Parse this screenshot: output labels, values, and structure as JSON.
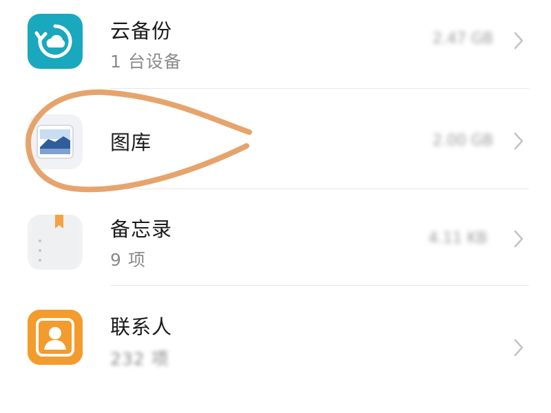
{
  "items": [
    {
      "title": "云备份",
      "subtitle": "1 台设备",
      "value": "2.47 GB",
      "icon": "cloud-backup-icon"
    },
    {
      "title": "图库",
      "subtitle": "",
      "value": "2.00 GB",
      "icon": "gallery-icon"
    },
    {
      "title": "备忘录",
      "subtitle": "9 项",
      "value": "4.11 KB",
      "icon": "notes-icon"
    },
    {
      "title": "联系人",
      "subtitle": "232 项",
      "value": "",
      "icon": "contacts-icon"
    }
  ],
  "colors": {
    "cloud_icon_bg": "#19a8bd",
    "contacts_icon_bg": "#f39b2c",
    "annotation_stroke": "#e39a5c",
    "title_text": "#1a1a1a",
    "subtitle_text": "#8a8a8a",
    "divider": "#e6e6e6"
  }
}
